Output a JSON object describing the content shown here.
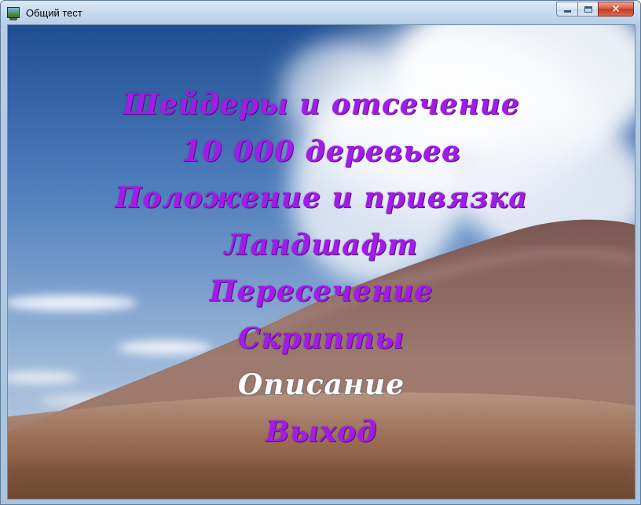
{
  "window": {
    "title": "Общий тест",
    "icon": "app-icon",
    "controls": {
      "minimize": "minimize-icon",
      "maximize": "maximize-icon",
      "close": "close-icon"
    }
  },
  "menu": {
    "items": [
      {
        "label": "Шейдеры и отсечение"
      },
      {
        "label": "10 000 деревьев"
      },
      {
        "label": "Положение и привязка"
      },
      {
        "label": "Ландшафт"
      },
      {
        "label": "Пересечение"
      },
      {
        "label": "Скрипты"
      },
      {
        "label": "Описание",
        "selected": true
      },
      {
        "label": "Выход"
      }
    ],
    "colors": {
      "item": "#a21ce8",
      "selected": "#ffffff"
    }
  }
}
